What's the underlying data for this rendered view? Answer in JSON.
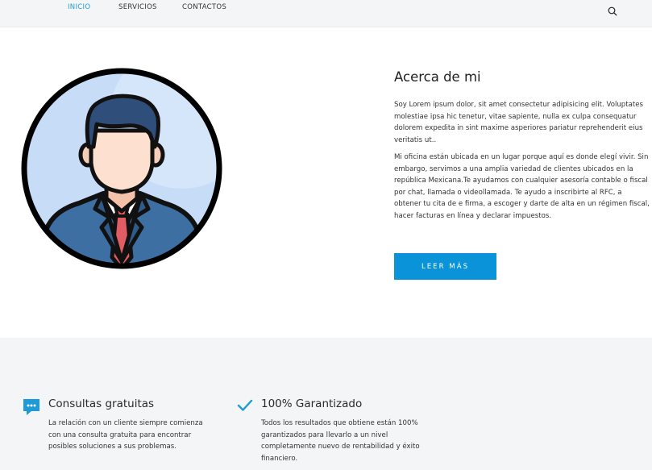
{
  "nav": {
    "items": [
      {
        "label": "INICIO",
        "active": true
      },
      {
        "label": "SERVICIOS",
        "active": false
      },
      {
        "label": "CONTACTOS",
        "active": false
      }
    ],
    "search_icon": "search-icon"
  },
  "about": {
    "title": "Acerca de mi",
    "paragraph1": "Soy Lorem ipsum dolor, sit amet consectetur adipisicing elit. Voluptates molestiae ipsa hic tenetur, vitae sapiente, nulla ex culpa consequatur dolorem expedita in sint maxime asperiores pariatur reprehenderit eius veritatis ut..",
    "paragraph2": "Mi oficina están ubicada en un lugar porque aquí es donde elegí vivir. Sin embargo, servimos a una amplia variedad de clientes ubicados en la república Mexicana.Te ayudamos con cualquier asesoría contable o fiscal por chat, llamada o videollamada. Te ayudo a inscribirte al RFC, a obtener tu cita de e firma, a escoger y darte de alta en un régimen fiscal, hacer facturas en línea y declarar impuestos.",
    "button_label": "LEER MÁS",
    "avatar_icon": "businessman-avatar-icon"
  },
  "features": [
    {
      "icon": "chat-bubble-icon",
      "title": "Consultas gratuitas",
      "text": "La relación con un cliente siempre comienza con una consulta gratuita para encontrar posibles soluciones a sus problemas."
    },
    {
      "icon": "checkmark-icon",
      "title": "100% Garantizado",
      "text": "Todos los resultados que obtiene están 100% garantizados para llevarlo a un nivel completamente nuevo de rentabilidad y éxito financiero."
    }
  ],
  "colors": {
    "accent": "#1e9bd7",
    "button": "#0a93d8",
    "band_bg": "#f4f5f7"
  }
}
